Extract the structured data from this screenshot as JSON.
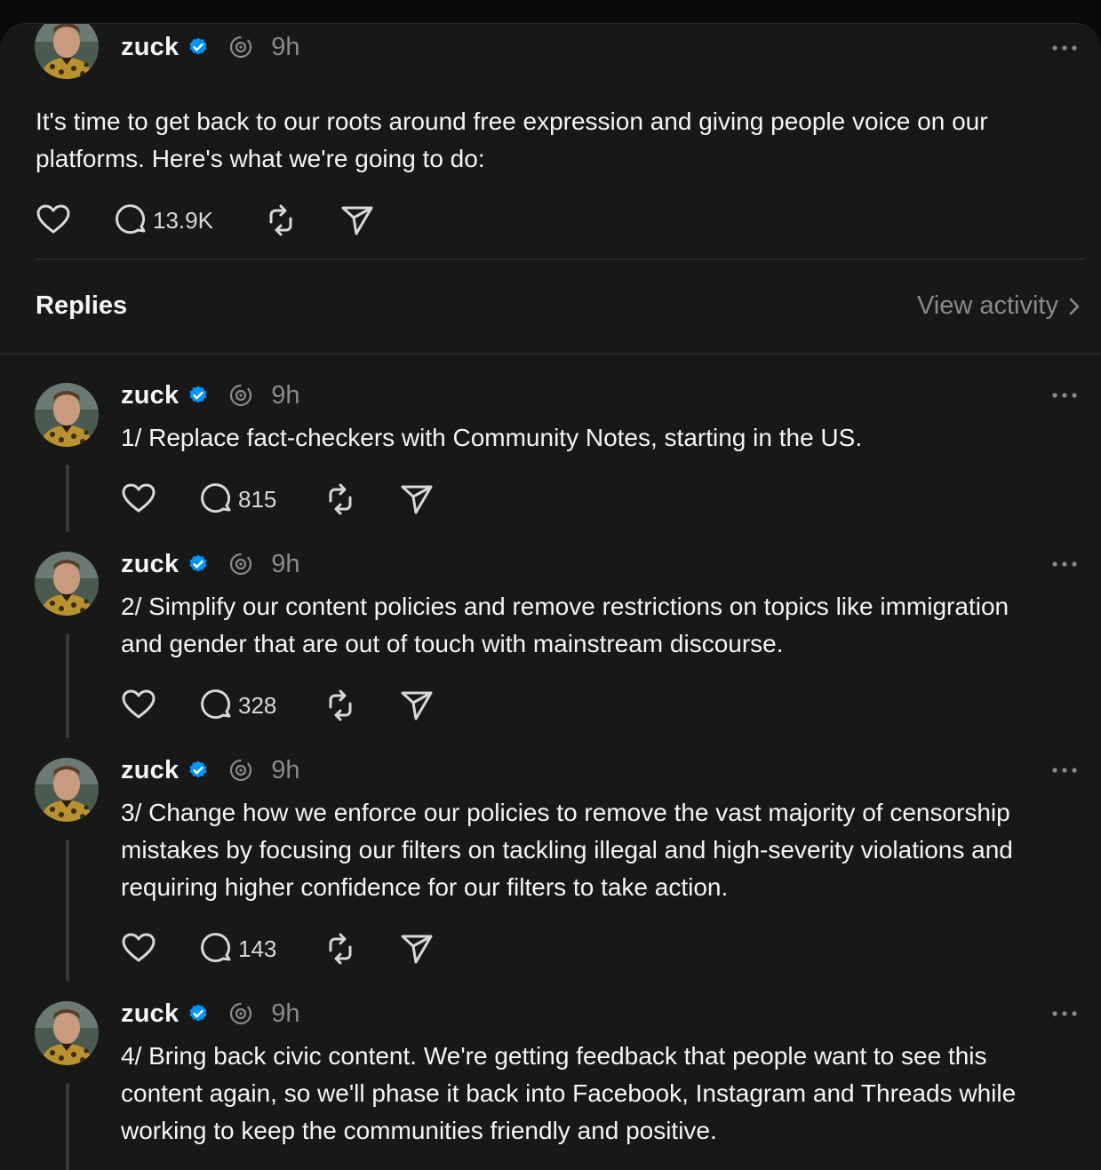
{
  "colors": {
    "background": "#181818",
    "text": "#f3f5f7",
    "muted": "#8a8a8a",
    "verified": "#0095f6",
    "divider": "#323232"
  },
  "main_post": {
    "username": "zuck",
    "time": "9h",
    "text": "It's time to get back to our roots around free expression and giving people voice on our platforms. Here's what we're going to do:",
    "reply_count": "13.9K"
  },
  "replies_header": {
    "title": "Replies",
    "view_activity": "View activity"
  },
  "replies": [
    {
      "username": "zuck",
      "time": "9h",
      "text": "1/ Replace fact-checkers with Community Notes, starting in the US.",
      "reply_count": "815"
    },
    {
      "username": "zuck",
      "time": "9h",
      "text": "2/ Simplify our content policies and remove restrictions on topics like immigration and gender that are out of touch with mainstream discourse.",
      "reply_count": "328"
    },
    {
      "username": "zuck",
      "time": "9h",
      "text": "3/ Change how we enforce our policies to remove the vast majority of censorship mistakes by focusing our filters on tackling illegal and high-severity violations and requiring higher confidence for our filters to take action.",
      "reply_count": "143"
    },
    {
      "username": "zuck",
      "time": "9h",
      "text": "4/ Bring back civic content. We're getting feedback that people want to see this content again, so we'll phase it back into Facebook, Instagram and Threads while working to keep the communities friendly and positive."
    }
  ],
  "icons": {
    "verified": "verified-badge-icon",
    "threads": "threads-logo-icon",
    "like": "heart-icon",
    "reply": "comment-icon",
    "repost": "repost-icon",
    "share": "send-icon",
    "more": "more-dots-icon",
    "chevron": "chevron-right-icon"
  }
}
